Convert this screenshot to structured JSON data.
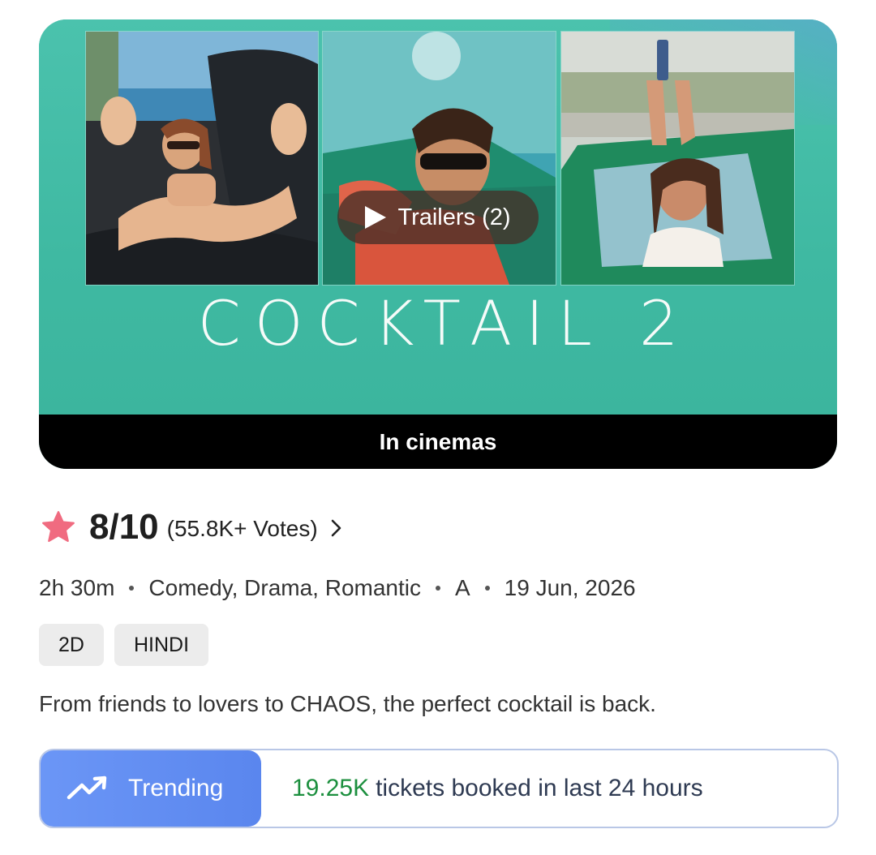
{
  "poster": {
    "movie_title": "COCKTAIL 2",
    "trailer_label": "Trailers (2)",
    "availability": "In cinemas",
    "background_color": "#46bda7"
  },
  "rating": {
    "icon": "star-icon",
    "star_color": "#f06b80",
    "score": "8/10",
    "votes": "(55.8K+ Votes)"
  },
  "meta": {
    "duration": "2h 30m",
    "genres": "Comedy, Drama, Romantic",
    "certificate": "A",
    "release_date": "19 Jun, 2026"
  },
  "formats": [
    "2D",
    "HINDI"
  ],
  "tagline": "From friends to lovers to CHAOS, the perfect cocktail is back.",
  "trending": {
    "icon": "trending-up-icon",
    "label": "Trending",
    "count": "19.25K",
    "text": "tickets booked in last 24 hours",
    "accent_color": "#5a86ee",
    "count_color": "#1c8f3e"
  }
}
